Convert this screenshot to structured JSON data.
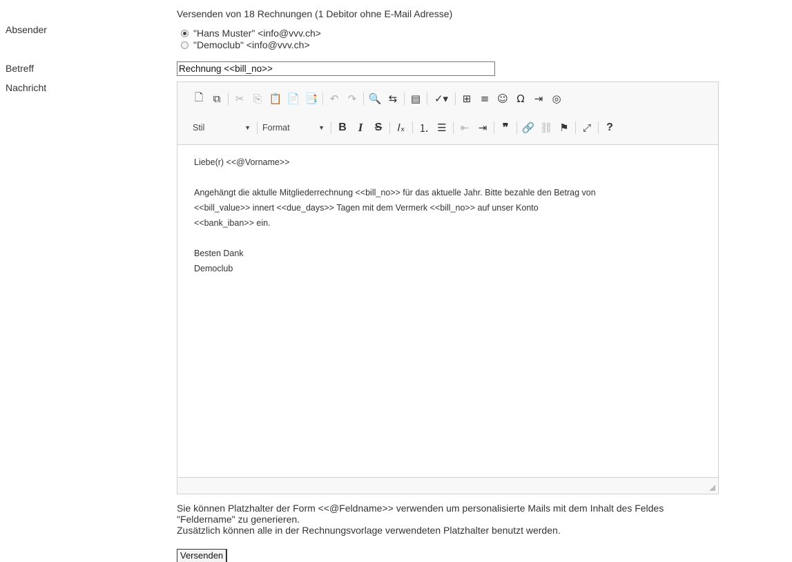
{
  "header_info": "Versenden von 18 Rechnungen (1 Debitor ohne E-Mail Adresse)",
  "labels": {
    "sender": "Absender",
    "subject": "Betreff",
    "message": "Nachricht"
  },
  "sender_options": [
    {
      "label": "\"Hans Muster\" <info@vvv.ch>",
      "selected": true
    },
    {
      "label": "\"Democlub\" <info@vvv.ch>",
      "selected": false
    }
  ],
  "subject_value": "Rechnung <<bill_no>>",
  "toolbar": {
    "style_combo": "Stil",
    "format_combo": "Format",
    "bold": "B",
    "italic": "I",
    "strike": "S",
    "help": "?"
  },
  "message": {
    "greeting": "Liebe(r) <<@Vorname>>",
    "body_line1": "Angehängt die aktulle Mitgliederrechnung <<bill_no>> für das aktuelle Jahr. Bitte bezahle den Betrag von",
    "body_line2": "<<bill_value>> innert <<due_days>> Tagen mit dem Vermerk <<bill_no>> auf unser Konto",
    "body_line3": "<<bank_iban>> ein.",
    "closing1": "Besten Dank",
    "closing2": "Democlub"
  },
  "help_text": {
    "line1": "Sie können Platzhalter der Form <<@Feldname>> verwenden um personalisierte Mails mit dem Inhalt des Feldes",
    "line2": "\"Feldername\" zu generieren.",
    "line3": "Zusätzlich können alle in der Rechnungsvorlage verwendeten Platzhalter benutzt werden."
  },
  "send_button": "Versenden"
}
